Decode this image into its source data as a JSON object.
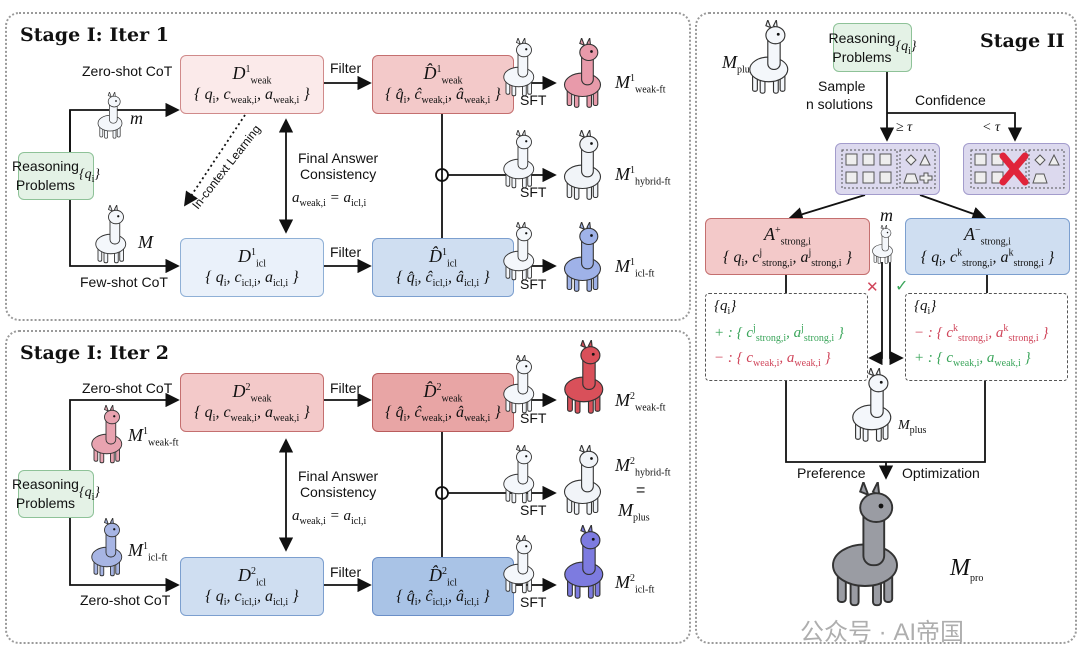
{
  "iter1": {
    "title": "Stage I: Iter 1",
    "reasoning": {
      "label_line1": "Reasoning",
      "label_line2": "Problems",
      "set": [
        [
          "{q",
          "i",
          ""
        ]
      ]
    },
    "zero_shot": "Zero-shot CoT",
    "few_shot": "Few-shot CoT",
    "filter_top": "Filter",
    "filter_bottom": "Filter",
    "icl": "In-context Learning",
    "small_model": [
      [
        "m",
        "",
        ""
      ]
    ],
    "big_model": [
      [
        "M",
        "",
        ""
      ]
    ],
    "consistency_line1": "Final Answer",
    "consistency_line2": "Consistency",
    "consistency_eq": [
      [
        "a",
        "weak,i",
        ""
      ],
      [
        " = ",
        "",
        ""
      ],
      [
        "a",
        "icl,i",
        ""
      ]
    ],
    "sft": [
      "SFT",
      "SFT",
      "SFT"
    ],
    "d_weak": {
      "head": [
        [
          "D",
          "weak",
          "1"
        ]
      ],
      "tuple": [
        [
          "{ q",
          "i",
          ""
        ],
        [
          ", c",
          "weak,i",
          ""
        ],
        [
          ", a",
          "weak,i",
          ""
        ],
        [
          " }",
          "",
          ""
        ]
      ]
    },
    "dhat_weak": {
      "head": [
        [
          "D̂",
          "weak",
          "1"
        ]
      ],
      "tuple": [
        [
          "{ q̂",
          "i",
          ""
        ],
        [
          ", ĉ",
          "weak,i",
          ""
        ],
        [
          ", â",
          "weak,i",
          ""
        ],
        [
          " }",
          "",
          ""
        ]
      ]
    },
    "d_icl": {
      "head": [
        [
          "D",
          "icl",
          "1"
        ]
      ],
      "tuple": [
        [
          "{ q",
          "i",
          ""
        ],
        [
          ", c",
          "icl,i",
          ""
        ],
        [
          ", a",
          "icl,i",
          ""
        ],
        [
          " }",
          "",
          ""
        ]
      ]
    },
    "dhat_icl": {
      "head": [
        [
          "D̂",
          "icl",
          "1"
        ]
      ],
      "tuple": [
        [
          "{ q̂",
          "i",
          ""
        ],
        [
          ", ĉ",
          "icl,i",
          ""
        ],
        [
          ", â",
          "icl,i",
          ""
        ],
        [
          " }",
          "",
          ""
        ]
      ]
    },
    "outputs": [
      [
        [
          "M",
          "weak-ft",
          "1"
        ]
      ],
      [
        [
          "M",
          "hybrid-ft",
          "1"
        ]
      ],
      [
        [
          "M",
          "icl-ft",
          "1"
        ]
      ]
    ]
  },
  "iter2": {
    "title": "Stage I: Iter 2",
    "reasoning": {
      "label_line1": "Reasoning",
      "label_line2": "Problems",
      "set": [
        [
          "{q",
          "i",
          ""
        ]
      ]
    },
    "zero_shot_top": "Zero-shot CoT",
    "zero_shot_bottom": "Zero-shot CoT",
    "filter_top": "Filter",
    "filter_bottom": "Filter",
    "model_top": [
      [
        "M",
        "weak-ft",
        "1"
      ]
    ],
    "model_bottom": [
      [
        "M",
        "icl-ft",
        "1"
      ]
    ],
    "consistency_line1": "Final Answer",
    "consistency_line2": "Consistency",
    "consistency_eq": [
      [
        "a",
        "weak,i",
        ""
      ],
      [
        " = ",
        "",
        ""
      ],
      [
        "a",
        "icl,i",
        ""
      ]
    ],
    "sft": [
      "SFT",
      "SFT",
      "SFT"
    ],
    "d_weak": {
      "head": [
        [
          "D",
          "weak",
          "2"
        ]
      ],
      "tuple": [
        [
          "{ q",
          "i",
          ""
        ],
        [
          ", c",
          "weak,i",
          ""
        ],
        [
          ", a",
          "weak,i",
          ""
        ],
        [
          " }",
          "",
          ""
        ]
      ]
    },
    "dhat_weak": {
      "head": [
        [
          "D̂",
          "weak",
          "2"
        ]
      ],
      "tuple": [
        [
          "{ q̂",
          "i",
          ""
        ],
        [
          ", ĉ",
          "weak,i",
          ""
        ],
        [
          ", â",
          "weak,i",
          ""
        ],
        [
          " }",
          "",
          ""
        ]
      ]
    },
    "d_icl": {
      "head": [
        [
          "D",
          "icl",
          "2"
        ]
      ],
      "tuple": [
        [
          "{ q",
          "i",
          ""
        ],
        [
          ", c",
          "icl,i",
          ""
        ],
        [
          ", a",
          "icl,i",
          ""
        ],
        [
          " }",
          "",
          ""
        ]
      ]
    },
    "dhat_icl": {
      "head": [
        [
          "D̂",
          "icl",
          "2"
        ]
      ],
      "tuple": [
        [
          "{ q̂",
          "i",
          ""
        ],
        [
          ", ĉ",
          "icl,i",
          ""
        ],
        [
          ", â",
          "icl,i",
          ""
        ],
        [
          " }",
          "",
          ""
        ]
      ]
    },
    "outputs": [
      [
        [
          "M",
          "weak-ft",
          "2"
        ]
      ],
      [
        [
          "M",
          "hybrid-ft",
          "2"
        ]
      ],
      [
        [
          "M",
          "icl-ft",
          "2"
        ]
      ]
    ],
    "equals": "=",
    "plus_model": [
      [
        "M",
        "plus",
        ""
      ]
    ]
  },
  "stage2": {
    "title": "Stage II",
    "reasoning": {
      "label_line1": "Reasoning",
      "label_line2": "Problems",
      "set": [
        [
          "{q",
          "i",
          ""
        ]
      ]
    },
    "plus_model": [
      [
        "M",
        "plus",
        ""
      ]
    ],
    "sample_line1": "Sample",
    "sample_line2": "n solutions",
    "confidence": "Confidence",
    "geq_tau": "≥ τ",
    "lt_tau": "< τ",
    "a_plus": {
      "head": [
        [
          "A",
          "strong,i",
          "+"
        ]
      ],
      "tuple": [
        [
          "{ q",
          "i",
          ""
        ],
        [
          ", c",
          "strong,i",
          "j"
        ],
        [
          ", a",
          "strong,i",
          "j"
        ],
        [
          " }",
          "",
          ""
        ]
      ]
    },
    "a_minus": {
      "head": [
        [
          "A",
          "strong,i",
          "−"
        ]
      ],
      "tuple": [
        [
          "{ q",
          "i",
          ""
        ],
        [
          ", c",
          "strong,i",
          "k"
        ],
        [
          ", a",
          "strong,i",
          "k"
        ],
        [
          " }",
          "",
          ""
        ]
      ]
    },
    "small_model": [
      [
        "m",
        "",
        ""
      ]
    ],
    "left_pref": {
      "q": [
        [
          "{q",
          "i",
          "}"
        ]
      ],
      "pos": [
        [
          "+ : { c",
          "strong,i",
          "j"
        ],
        [
          ", a",
          "strong,i",
          "j"
        ],
        [
          " }",
          "",
          ""
        ]
      ],
      "neg": [
        [
          "− : { c",
          "weak,i",
          ""
        ],
        [
          ", a",
          "weak,i",
          ""
        ],
        [
          " }",
          "",
          ""
        ]
      ]
    },
    "right_pref": {
      "q": [
        [
          "{q",
          "i",
          "}"
        ]
      ],
      "neg": [
        [
          "− : { c",
          "strong,i",
          "k"
        ],
        [
          ", a",
          "strong,i",
          "k"
        ],
        [
          " }",
          "",
          ""
        ]
      ],
      "pos": [
        [
          "+ : { c",
          "weak,i",
          ""
        ],
        [
          ", a",
          "weak,i",
          ""
        ],
        [
          " }",
          "",
          ""
        ]
      ]
    },
    "cross": "✕",
    "check": "✓",
    "preference": "Preference",
    "optimization": "Optimization",
    "plus_model_bottom": [
      [
        "M",
        "plus",
        ""
      ]
    ],
    "pro_model": [
      [
        "M",
        "pro",
        ""
      ]
    ]
  },
  "watermark": "公众号 · AI帝国",
  "colors": {
    "weak": "#f3c9c9",
    "icl": "#cfdef1",
    "green": "#e4f2e6",
    "pos": "#3aa55a",
    "neg": "#d0455a"
  }
}
